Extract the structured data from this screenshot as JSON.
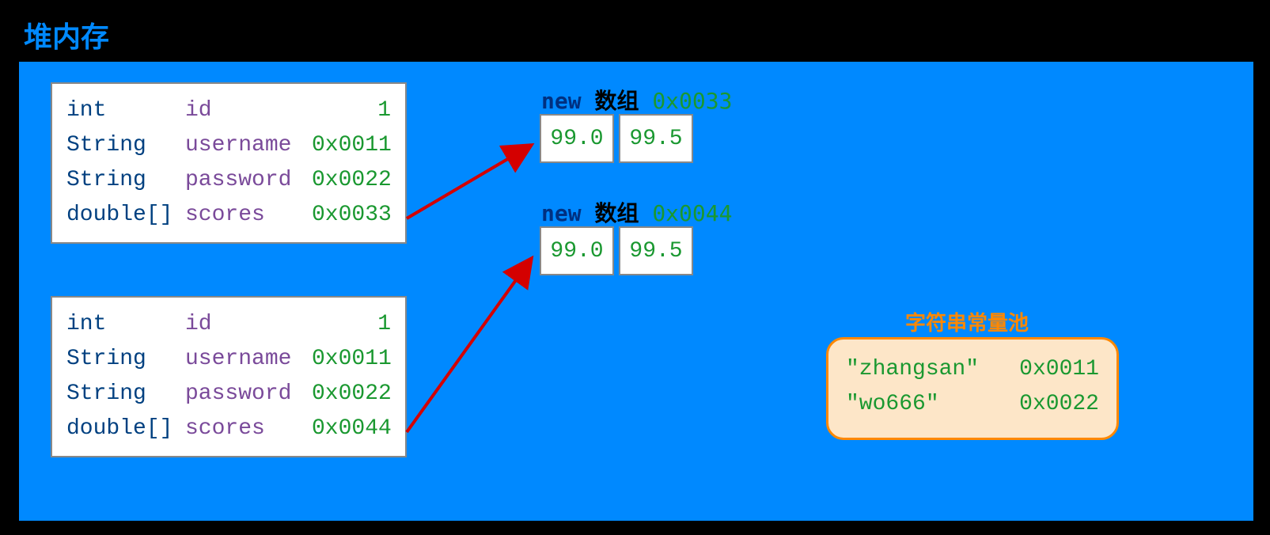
{
  "title": "堆内存",
  "objects": [
    {
      "fields": [
        {
          "type": "int",
          "name": "id",
          "value": "1"
        },
        {
          "type": "String",
          "name": "username",
          "value": "0x0011"
        },
        {
          "type": "String",
          "name": "password",
          "value": "0x0022"
        },
        {
          "type": "double[]",
          "name": "scores",
          "value": "0x0033"
        }
      ]
    },
    {
      "fields": [
        {
          "type": "int",
          "name": "id",
          "value": "1"
        },
        {
          "type": "String",
          "name": "username",
          "value": "0x0011"
        },
        {
          "type": "String",
          "name": "password",
          "value": "0x0022"
        },
        {
          "type": "double[]",
          "name": "scores",
          "value": "0x0044"
        }
      ]
    }
  ],
  "arrays": [
    {
      "label_new": "new",
      "label_type": "数组",
      "address": "0x0033",
      "values": [
        "99.0",
        "99.5"
      ]
    },
    {
      "label_new": "new",
      "label_type": "数组",
      "address": "0x0044",
      "values": [
        "99.0",
        "99.5"
      ]
    }
  ],
  "string_pool": {
    "title": "字符串常量池",
    "entries": [
      {
        "value": "\"zhangsan\"",
        "address": "0x0011"
      },
      {
        "value": "\"wo666\"",
        "address": "0x0022"
      }
    ]
  }
}
